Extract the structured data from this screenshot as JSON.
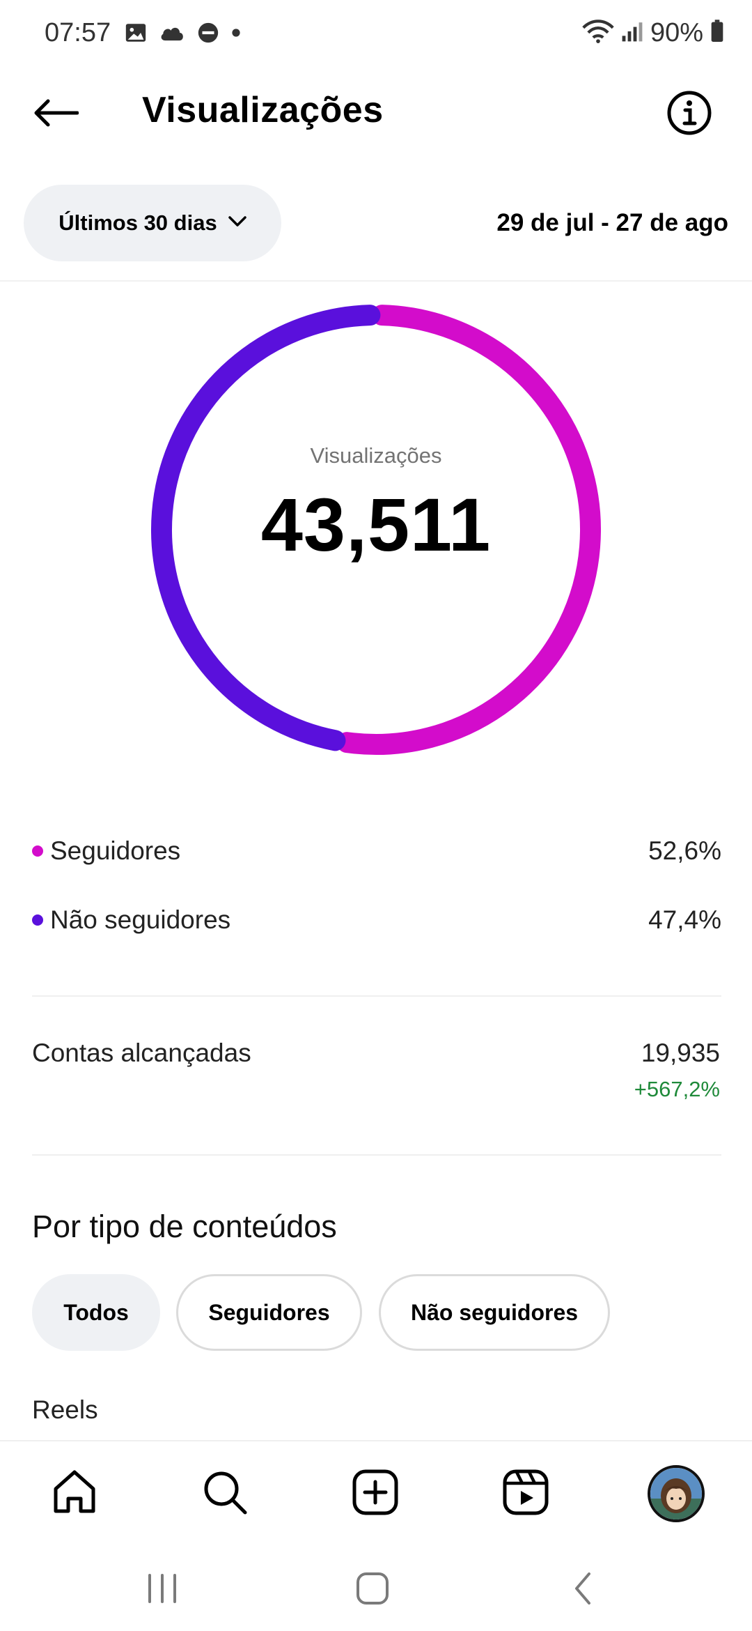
{
  "status_bar": {
    "time": "07:57",
    "battery": "90%",
    "icons": [
      "image-icon",
      "cloud-icon",
      "do-not-disturb-icon",
      "dot-icon",
      "wifi-icon",
      "signal-icon",
      "battery-icon"
    ]
  },
  "header": {
    "title": "Visualizações",
    "back_icon": "arrow-left-icon",
    "info_icon": "info-icon"
  },
  "filter": {
    "range_label": "Últimos 30 dias",
    "date_range": "29 de jul - 27 de ago"
  },
  "chart_data": {
    "type": "pie",
    "center_caption": "Visualizações",
    "center_value": "43,511",
    "categories": [
      "Seguidores",
      "Não seguidores"
    ],
    "values": [
      52.6,
      47.4
    ],
    "colors": [
      "#d30ccb",
      "#5a10dc"
    ]
  },
  "breakdown": [
    {
      "label": "Seguidores",
      "value": "52,6%",
      "color": "#d30ccb"
    },
    {
      "label": "Não seguidores",
      "value": "47,4%",
      "color": "#5a10dc"
    }
  ],
  "reach": {
    "label": "Contas alcançadas",
    "value": "19,935",
    "change": "+567,2%",
    "change_color": "#1f8a3a"
  },
  "content_type": {
    "title": "Por tipo de conteúdos",
    "chips": [
      {
        "label": "Todos",
        "active": true
      },
      {
        "label": "Seguidores",
        "active": false
      },
      {
        "label": "Não seguidores",
        "active": false
      }
    ],
    "first_item": "Reels"
  },
  "bottom_nav": {
    "items": [
      "home-icon",
      "search-icon",
      "create-icon",
      "reels-icon",
      "profile-avatar"
    ]
  },
  "system_nav": {
    "items": [
      "recents-icon",
      "home-button-icon",
      "back-icon"
    ]
  }
}
